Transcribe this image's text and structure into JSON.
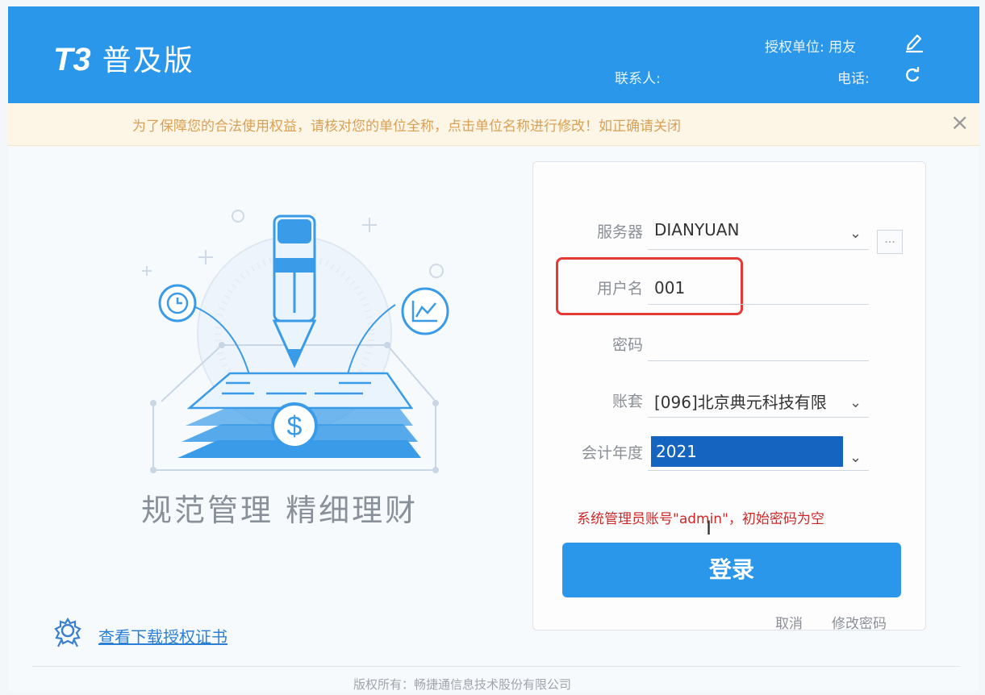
{
  "header": {
    "logo_t3": "T3",
    "logo_text": "普及版",
    "license_label": "授权单位: 用友",
    "contact_label": "联系人:",
    "phone_label": "电话:"
  },
  "notice": {
    "text": "为了保障您的合法使用权益，请核对您的单位全称，点击单位名称进行修改！如正确请关闭",
    "close_symbol": "×"
  },
  "slogan": "规范管理  精细理财",
  "login": {
    "server_label": "服务器",
    "server_value": "DIANYUAN",
    "username_label": "用户名",
    "username_value": "001",
    "password_label": "密码",
    "password_value": "",
    "account_label": "账套",
    "account_value": "[096]北京典元科技有限",
    "year_label": "会计年度",
    "year_value": "2021",
    "more_button": "...",
    "hint": "系统管理员账号\"admin\"，初始密码为空",
    "login_button": "登录",
    "cancel": "取消",
    "change_password": "修改密码"
  },
  "cert_link": "查看下载授权证书",
  "copyright": "版权所有：畅捷通信息技术股份有限公司",
  "colors": {
    "header_bg": "#2a97ea",
    "notice_text": "#d9a055",
    "hint_red": "#d12626",
    "highlight_red": "#e53935",
    "selected_blue": "#1565c0"
  }
}
